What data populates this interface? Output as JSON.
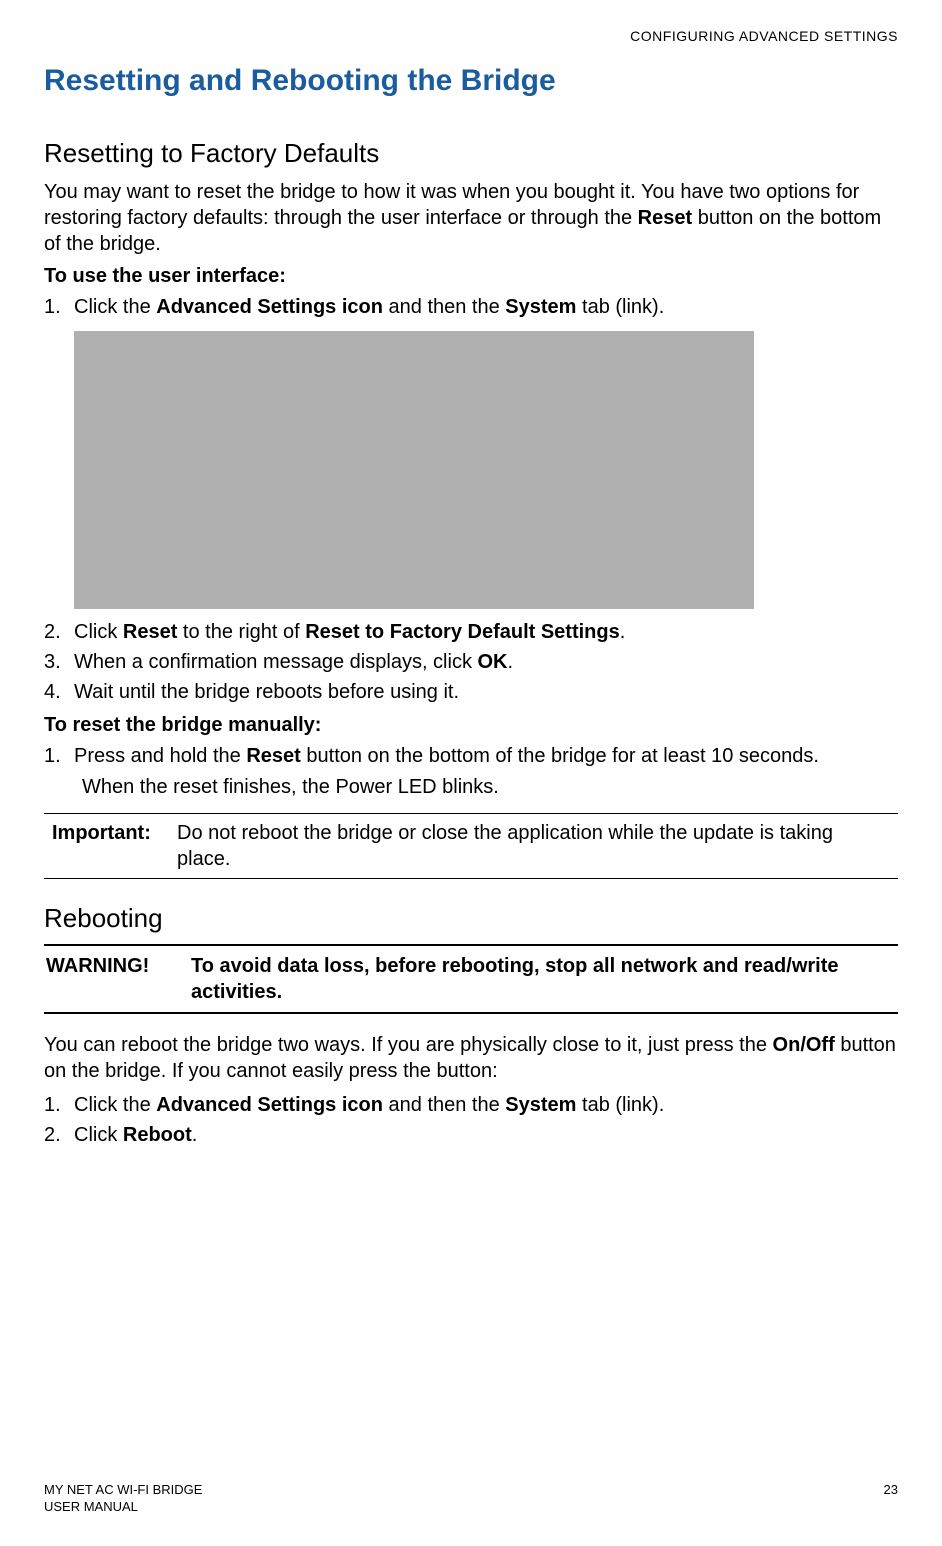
{
  "headerSection": "CONFIGURING ADVANCED SETTINGS",
  "mainTitle": "Resetting and Rebooting the Bridge",
  "section1": {
    "heading": "Resetting to Factory Defaults",
    "intro_part1": "You may want to reset the bridge to how it was when you bought it. You have two options for restoring factory defaults: through the user interface or through the ",
    "intro_bold": "Reset",
    "intro_part2": " button on the bottom of the bridge.",
    "uiHeading": "To use the user interface:",
    "step1_num": "1.",
    "step1_a": "Click the ",
    "step1_b": "Advanced Settings icon",
    "step1_c": " and then the ",
    "step1_d": "System",
    "step1_e": " tab (link).",
    "step2_num": "2.",
    "step2_a": "Click ",
    "step2_b": "Reset",
    "step2_c": " to the right of ",
    "step2_d": "Reset to Factory Default Settings",
    "step2_e": ".",
    "step3_num": "3.",
    "step3_a": "When a confirmation message displays, click ",
    "step3_b": "OK",
    "step3_c": ".",
    "step4_num": "4.",
    "step4": "Wait until the bridge reboots before using it.",
    "manualHeading": "To reset the bridge manually:",
    "mstep1_num": "1.",
    "mstep1_a": "Press and hold the ",
    "mstep1_b": "Reset",
    "mstep1_c": " button on the bottom of the bridge for at least 10 seconds.",
    "mstep1_sub": "When the reset finishes, the Power LED blinks.",
    "noteLabel": "Important:",
    "noteText": "Do not reboot the bridge or close the application while the update is taking place."
  },
  "section2": {
    "heading": "Rebooting",
    "warnLabel": "WARNING!",
    "warnText": "To avoid data loss, before rebooting, stop all network and read/write activities.",
    "intro_a": "You can reboot the bridge two ways. If you are physically close to it, just press the ",
    "intro_b": "On/Off",
    "intro_c": " button on the bridge. If you cannot easily press the button:",
    "step1_num": "1.",
    "step1_a": "Click the ",
    "step1_b": "Advanced Settings icon",
    "step1_c": " and then the ",
    "step1_d": "System",
    "step1_e": " tab (link).",
    "step2_num": "2.",
    "step2_a": "Click ",
    "step2_b": "Reboot",
    "step2_c": "."
  },
  "footer": {
    "line1": "MY NET AC WI-FI BRIDGE",
    "line2": "USER MANUAL",
    "pageNum": "23"
  }
}
